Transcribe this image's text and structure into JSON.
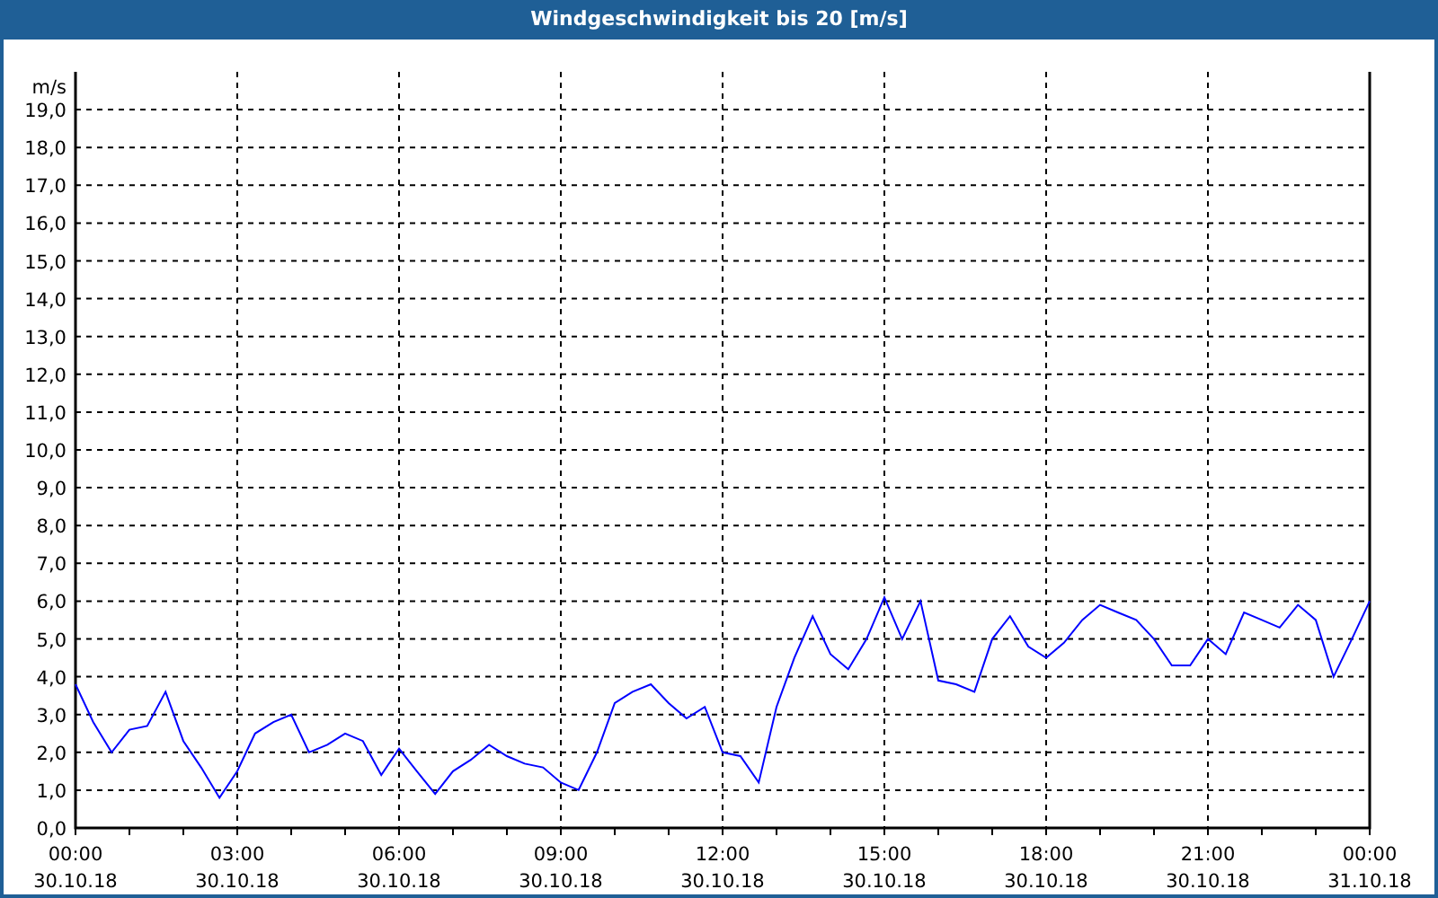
{
  "window": {
    "title": "Windgeschwindigkeit bis 20 [m/s]"
  },
  "chart": {
    "date_labels": [
      "30.10.18",
      "30.10.18",
      "30.10.18",
      "30.10.18",
      "30.10.18",
      "30.10.18",
      "30.10.18",
      "30.10.18",
      "31.10.18"
    ],
    "chart_data": {
      "type": "line",
      "grid": true,
      "ylabel": "m/s",
      "xlim": [
        0,
        24
      ],
      "ylim": [
        0,
        20
      ],
      "xticks": [
        {
          "value": 0,
          "label": "00:00"
        },
        {
          "value": 3,
          "label": "03:00"
        },
        {
          "value": 6,
          "label": "06:00"
        },
        {
          "value": 9,
          "label": "09:00"
        },
        {
          "value": 12,
          "label": "12:00"
        },
        {
          "value": 15,
          "label": "15:00"
        },
        {
          "value": 18,
          "label": "18:00"
        },
        {
          "value": 21,
          "label": "21:00"
        },
        {
          "value": 24,
          "label": "00:00"
        }
      ],
      "yticks": [
        {
          "value": 0,
          "label": "0,0"
        },
        {
          "value": 1,
          "label": "1,0"
        },
        {
          "value": 2,
          "label": "2,0"
        },
        {
          "value": 3,
          "label": "3,0"
        },
        {
          "value": 4,
          "label": "4,0"
        },
        {
          "value": 5,
          "label": "5,0"
        },
        {
          "value": 6,
          "label": "6,0"
        },
        {
          "value": 7,
          "label": "7,0"
        },
        {
          "value": 8,
          "label": "8,0"
        },
        {
          "value": 9,
          "label": "9,0"
        },
        {
          "value": 10,
          "label": "10,0"
        },
        {
          "value": 11,
          "label": "11,0"
        },
        {
          "value": 12,
          "label": "12,0"
        },
        {
          "value": 13,
          "label": "13,0"
        },
        {
          "value": 14,
          "label": "14,0"
        },
        {
          "value": 15,
          "label": "15,0"
        },
        {
          "value": 16,
          "label": "16,0"
        },
        {
          "value": 17,
          "label": "17,0"
        },
        {
          "value": 18,
          "label": "18,0"
        },
        {
          "value": 19,
          "label": "19,0"
        }
      ],
      "x": [
        0,
        0.33,
        0.67,
        1,
        1.33,
        1.67,
        2,
        2.33,
        2.67,
        3,
        3.33,
        3.67,
        4,
        4.33,
        4.67,
        5,
        5.33,
        5.67,
        6,
        6.33,
        6.67,
        7,
        7.33,
        7.67,
        8,
        8.33,
        8.67,
        9,
        9.33,
        9.67,
        10,
        10.33,
        10.67,
        11,
        11.33,
        11.67,
        12,
        12.33,
        12.67,
        13,
        13.33,
        13.67,
        14,
        14.33,
        14.67,
        15,
        15.33,
        15.67,
        16,
        16.33,
        16.67,
        17,
        17.33,
        17.67,
        18,
        18.33,
        18.67,
        19,
        19.33,
        19.67,
        20,
        20.33,
        20.67,
        21,
        21.33,
        21.67,
        22,
        22.33,
        22.67,
        23,
        23.33,
        23.67,
        24
      ],
      "series": [
        {
          "color": "#0000ff",
          "values": [
            3.8,
            2.8,
            2.0,
            2.6,
            2.7,
            3.6,
            2.3,
            1.6,
            0.8,
            1.5,
            2.5,
            2.8,
            3.0,
            2.0,
            2.2,
            2.5,
            2.3,
            1.4,
            2.1,
            1.5,
            0.9,
            1.5,
            1.8,
            2.2,
            1.9,
            1.7,
            1.6,
            1.2,
            1.0,
            2.0,
            3.3,
            3.6,
            3.8,
            3.3,
            2.9,
            3.2,
            2.0,
            1.9,
            1.2,
            3.2,
            4.5,
            5.6,
            4.6,
            4.2,
            5.0,
            6.1,
            5.0,
            6.0,
            3.9,
            3.8,
            3.6,
            5.0,
            5.6,
            4.8,
            4.5,
            4.9,
            5.5,
            5.9,
            5.7,
            5.5,
            5.0,
            4.3,
            4.3,
            5.0,
            4.6,
            5.7,
            5.5,
            5.3,
            5.9,
            5.5,
            4.0,
            5.0,
            6.0
          ]
        }
      ]
    }
  }
}
